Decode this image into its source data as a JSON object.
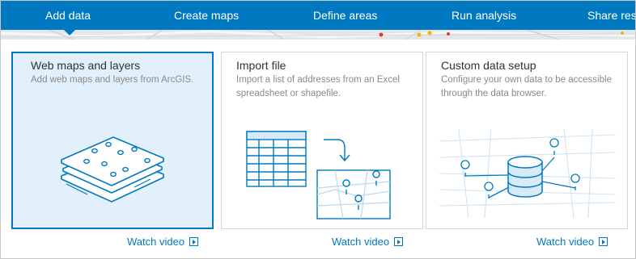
{
  "nav": {
    "tabs": [
      {
        "label": "Add data",
        "active": true
      },
      {
        "label": "Create maps",
        "active": false
      },
      {
        "label": "Define areas",
        "active": false
      },
      {
        "label": "Run analysis",
        "active": false
      },
      {
        "label": "Share resu",
        "active": false
      }
    ],
    "accent_color": "#0079c1"
  },
  "cards": [
    {
      "title": "Web maps and layers",
      "description": "Add web maps and layers from ArcGIS.",
      "selected": true,
      "watch_label": "Watch video",
      "illustration": "stacked-map-layers-icon"
    },
    {
      "title": "Import file",
      "description": "Import a list of addresses from an Excel spreadsheet or shapefile.",
      "selected": false,
      "watch_label": "Watch video",
      "illustration": "spreadsheet-to-map-icon"
    },
    {
      "title": "Custom data setup",
      "description": "Configure your own data to be accessible through the data browser.",
      "selected": false,
      "watch_label": "Watch video",
      "illustration": "database-network-icon"
    }
  ]
}
